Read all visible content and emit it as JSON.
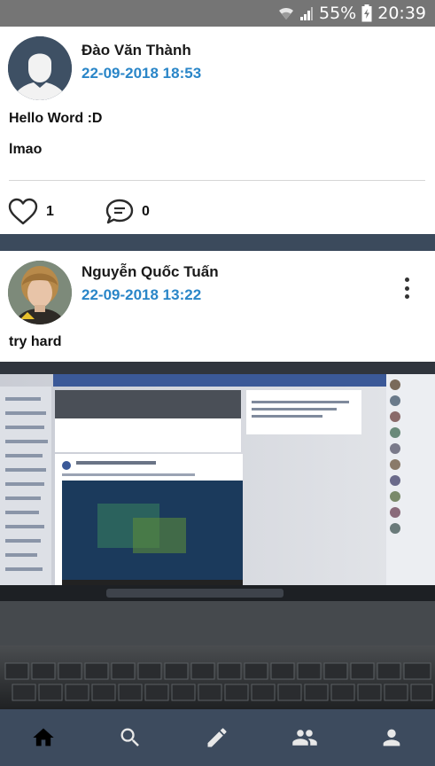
{
  "status_bar": {
    "battery": "55%",
    "time": "20:39"
  },
  "posts": [
    {
      "author": "Đào Văn Thành",
      "timestamp": "22-09-2018 18:53",
      "lines": [
        "Hello Word :D",
        "lmao"
      ],
      "likes": "1",
      "comments": "0"
    },
    {
      "author": "Nguyễn Quốc Tuấn",
      "timestamp": "22-09-2018 13:22",
      "lines": [
        "try hard"
      ]
    }
  ],
  "nav": [
    "home-icon",
    "search-icon",
    "pencil-icon",
    "people-icon",
    "person-icon"
  ],
  "colors": {
    "accent": "#2a86c8",
    "nav_bg": "#3d4b5e",
    "status_bg": "#757575"
  }
}
